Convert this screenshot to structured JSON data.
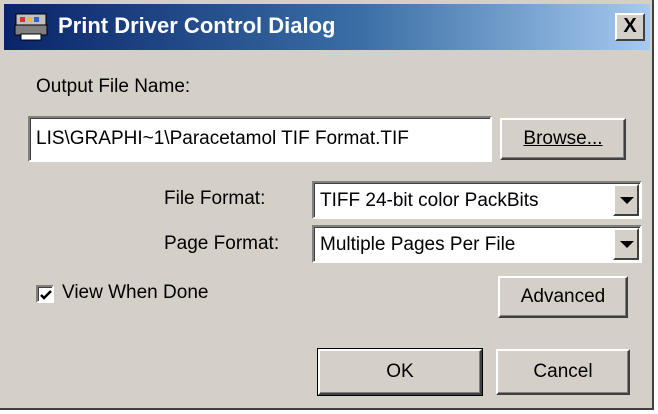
{
  "window": {
    "title": "Print Driver Control Dialog",
    "close_label": "X",
    "icon": "printer-icon"
  },
  "output_file": {
    "label": "Output File Name:",
    "value": "LIS\\GRAPHI~1\\Paracetamol TIF Format.TIF",
    "browse_label": "Browse..."
  },
  "file_format": {
    "label": "File Format:",
    "selected": "TIFF 24-bit color PackBits"
  },
  "page_format": {
    "label": "Page Format:",
    "selected": "Multiple Pages Per File"
  },
  "view_when_done": {
    "label": "View When Done",
    "checked": true
  },
  "buttons": {
    "advanced": "Advanced",
    "ok": "OK",
    "cancel": "Cancel"
  },
  "colors": {
    "titlebar_start": "#0a246a",
    "titlebar_end": "#a6caf0",
    "face": "#d4d0c8"
  }
}
